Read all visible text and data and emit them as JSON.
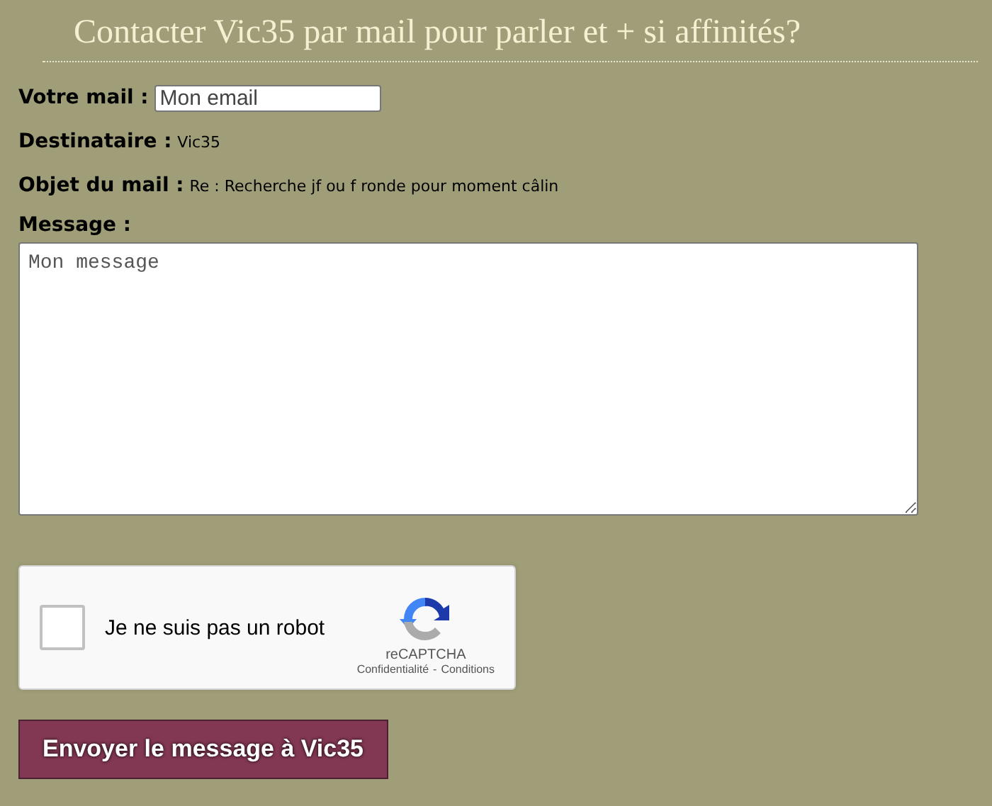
{
  "title": "Contacter Vic35 par mail pour parler et + si affinités?",
  "email": {
    "label": "Votre mail :",
    "placeholder": "Mon email"
  },
  "recipient": {
    "label": "Destinataire :",
    "value": "Vic35"
  },
  "subject": {
    "label": "Objet du mail :",
    "value": "Re : Recherche jf ou f ronde pour moment câlin"
  },
  "message": {
    "label": "Message :",
    "placeholder": "Mon message"
  },
  "captcha": {
    "label": "Je ne suis pas un robot",
    "checked": false,
    "brand": "reCAPTCHA",
    "privacy": "Confidentialité",
    "separator": "-",
    "terms": "Conditions"
  },
  "submit": "Envoyer le message à Vic35"
}
